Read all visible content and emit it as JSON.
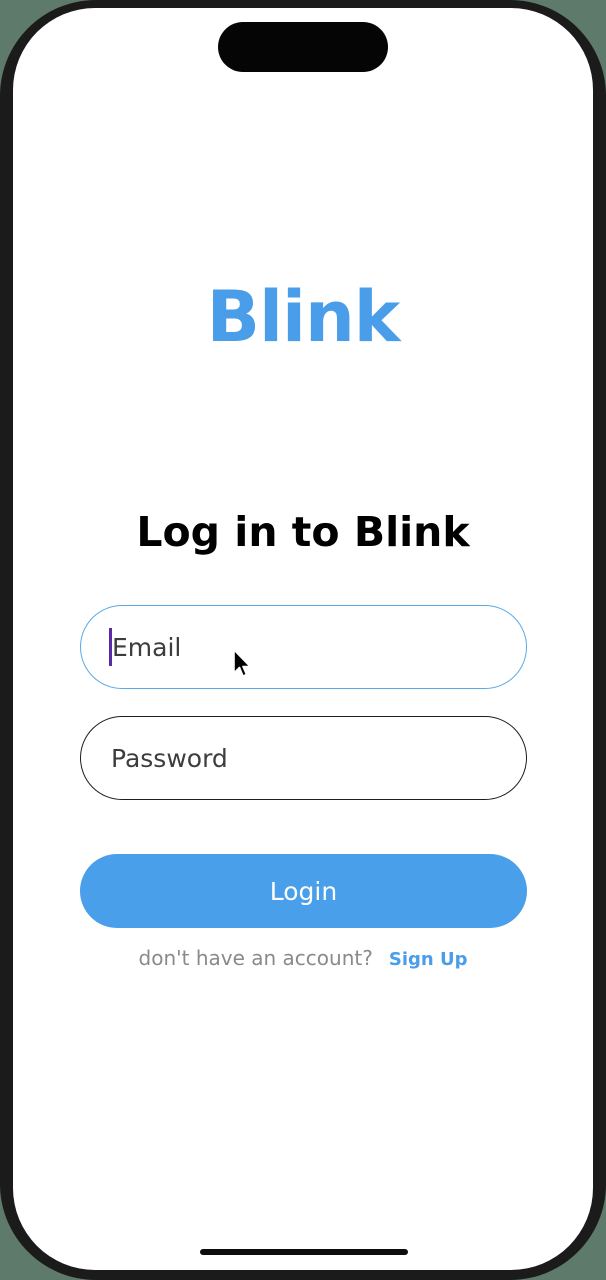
{
  "app": {
    "logo_text": "Blink",
    "accent_color": "#4a9de9"
  },
  "login": {
    "heading": "Log in to Blink",
    "email": {
      "placeholder": "Email",
      "value": "",
      "focused": true
    },
    "password": {
      "placeholder": "Password",
      "value": ""
    },
    "submit_label": "Login",
    "signup_prompt": "don't have an account?",
    "signup_link": "Sign Up"
  },
  "icons": {
    "pointer": "mouse-pointer-icon"
  }
}
